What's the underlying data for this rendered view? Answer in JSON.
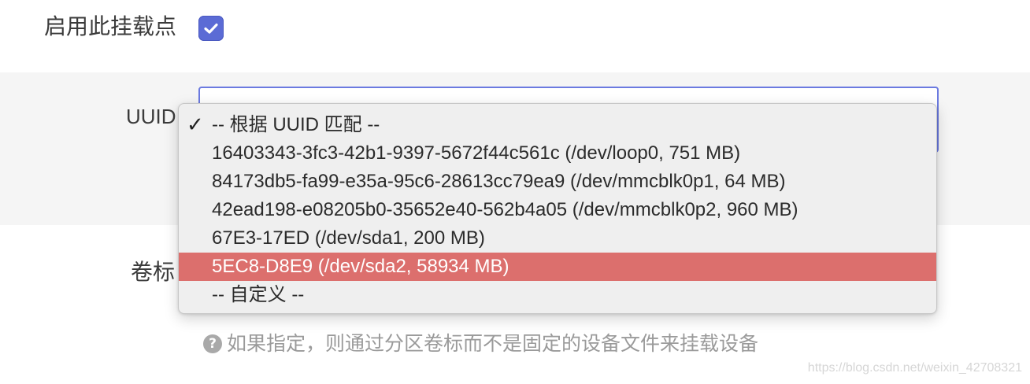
{
  "enable_mount": {
    "label": "启用此挂载点",
    "checked": true,
    "check_icon": "checkmark-icon",
    "accent_color": "#5b6bd5"
  },
  "uuid_field": {
    "label": "UUID"
  },
  "dropdown": {
    "selected_mark": "✓",
    "options": [
      {
        "label": "-- 根据 UUID 匹配 --",
        "selected": true
      },
      {
        "label": "16403343-3fc3-42b1-9397-5672f44c561c (/dev/loop0, 751 MB)"
      },
      {
        "label": "84173db5-fa99-e35a-95c6-28613cc79ea9 (/dev/mmcblk0p1, 64 MB)"
      },
      {
        "label": "42ead198-e08205b0-35652e40-562b4a05 (/dev/mmcblk0p2, 960 MB)"
      },
      {
        "label": "67E3-17ED (/dev/sda1, 200 MB)"
      },
      {
        "label": "5EC8-D8E9 (/dev/sda2, 58934 MB)",
        "highlighted": true
      },
      {
        "label": "-- 自定义 --"
      }
    ],
    "highlight_color": "#dc6f6d"
  },
  "volume_label": {
    "label": "卷标"
  },
  "help": {
    "icon": "question-circle-icon",
    "icon_glyph": "?",
    "text": "如果指定，则通过分区卷标而不是固定的设备文件来挂载设备"
  },
  "watermark": "https://blog.csdn.net/weixin_42708321"
}
